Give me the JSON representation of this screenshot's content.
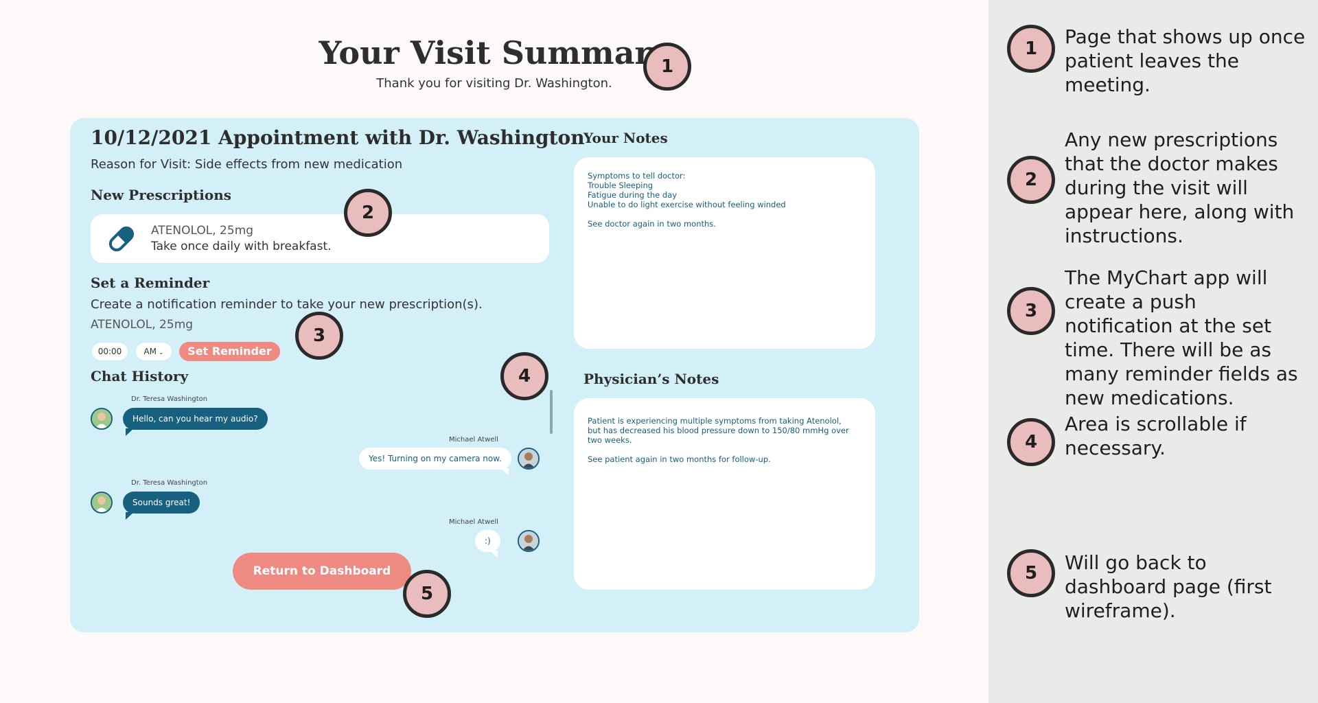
{
  "header": {
    "title": "Your Visit Summary",
    "subtitle": "Thank you for visiting Dr. Washington."
  },
  "appointment": {
    "title": "10/12/2021 Appointment with Dr. Washington",
    "reason": "Reason for Visit: Side effects from new medication"
  },
  "prescriptions": {
    "heading": "New Prescriptions",
    "items": [
      {
        "name": "ATENOLOL, 25mg",
        "instructions": "Take once daily with breakfast.",
        "icon": "pill-icon"
      }
    ]
  },
  "reminder": {
    "heading": "Set a Reminder",
    "description": "Create a notification reminder to take your new prescription(s).",
    "medication": "ATENOLOL, 25mg",
    "time": "00:00",
    "ampm": "AM",
    "button": "Set Reminder"
  },
  "chat": {
    "heading": "Chat History",
    "messages": [
      {
        "sender": "Dr. Teresa Washington",
        "text": "Hello, can you hear my audio?"
      },
      {
        "sender": "Michael Atwell",
        "text": "Yes! Turning on my camera now."
      },
      {
        "sender": "Dr. Teresa Washington",
        "text": "Sounds great!"
      },
      {
        "sender": "Michael Atwell",
        "text": ":)"
      }
    ]
  },
  "dashboard_button": "Return to Dashboard",
  "your_notes": {
    "heading": "Your Notes",
    "lines": [
      "Symptoms to tell doctor:",
      "Trouble Sleeping",
      "Fatigue during the day",
      "Unable to do light exercise without feeling winded",
      "",
      "See doctor again in two months."
    ]
  },
  "physician_notes": {
    "heading": "Physician’s Notes",
    "lines": [
      "Patient is experiencing multiple symptoms from taking Atenolol,",
      "but has decreased his blood pressure down to 150/80 mmHg over",
      "two weeks.",
      "",
      "See patient again in two months for follow-up."
    ]
  },
  "annotations": [
    {
      "number": "1",
      "text": "Page that shows up once patient leaves the meeting."
    },
    {
      "number": "2",
      "text": "Any new prescriptions that the doctor makes during the visit will appear here, along with instructions."
    },
    {
      "number": "3",
      "text": "The MyChart app will create a push notification at the set time. There will be as many reminder fields as new medications."
    },
    {
      "number": "4",
      "text": "Area is scrollable if necessary."
    },
    {
      "number": "5",
      "text": "Will go back to dashboard page (first wireframe)."
    }
  ],
  "colors": {
    "card_background": "#d3eff7",
    "accent_button": "#ef8a82",
    "doctor_bubble": "#17607f",
    "badge_fill": "#e9bcbd",
    "side_panel": "#e9ebe9"
  }
}
